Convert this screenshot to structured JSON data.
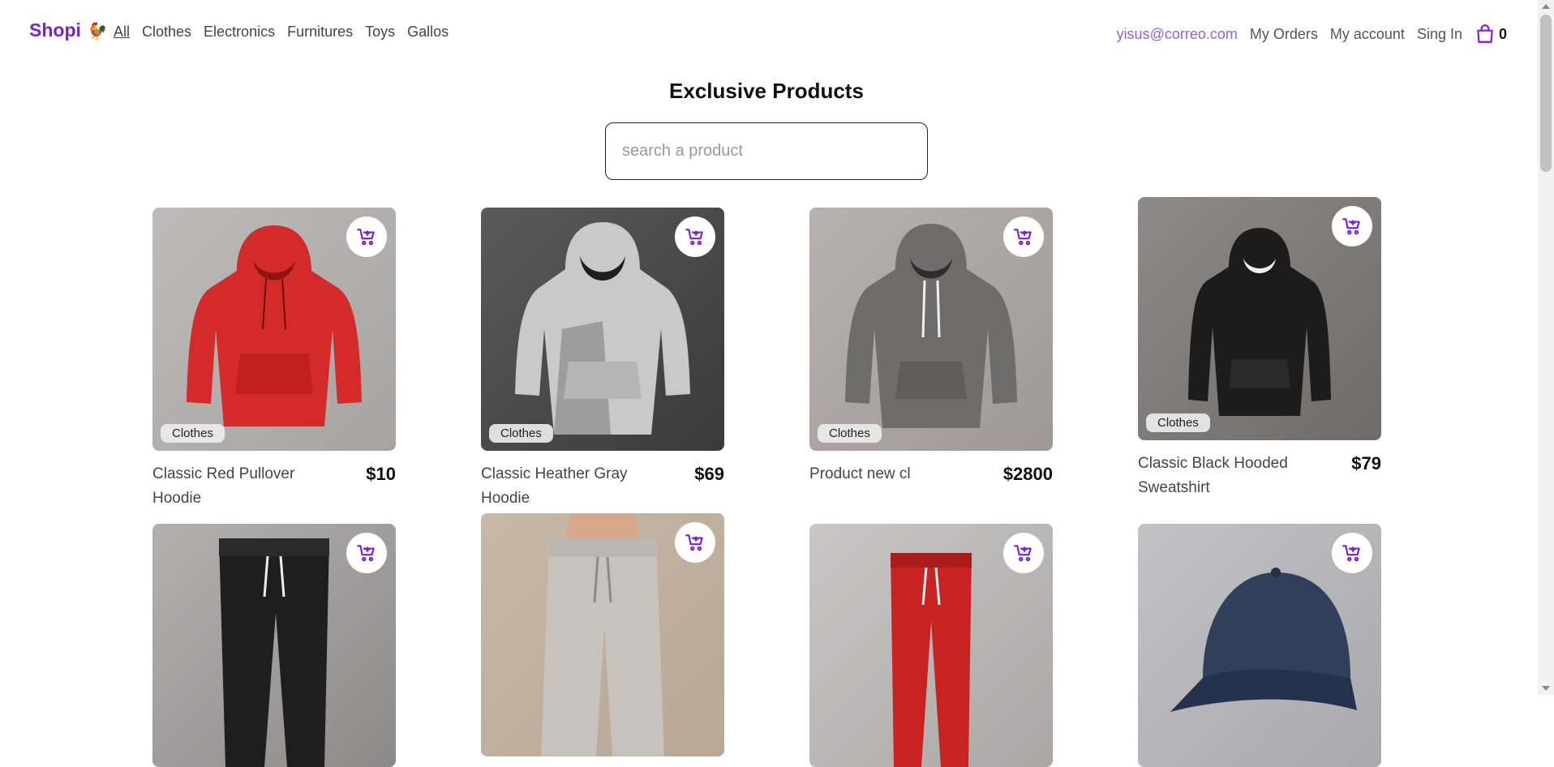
{
  "nav": {
    "logo": "Shopi",
    "logo_icon": "rooster-icon",
    "links": [
      "All",
      "Clothes",
      "Electronics",
      "Furnitures",
      "Toys",
      "Gallos"
    ],
    "email": "yisus@correo.com",
    "my_orders": "My Orders",
    "my_account": "My account",
    "sign_in": "Sing In",
    "cart_count": "0"
  },
  "main": {
    "title": "Exclusive Products",
    "search_placeholder": "search a product"
  },
  "products": [
    {
      "name": "Classic Red Pullover Hoodie",
      "price": "$10",
      "category": "Clothes",
      "image": "red-hoodie",
      "color": "#d42a2a"
    },
    {
      "name": "Classic Heather Gray Hoodie",
      "price": "$69",
      "category": "Clothes",
      "image": "gray-hoodie",
      "color": "#c9c9c9"
    },
    {
      "name": "Product new cl",
      "price": "$2800",
      "category": "Clothes",
      "image": "dark-gray-hoodie",
      "color": "#6f6c6c"
    },
    {
      "name": "Classic Black Hooded Sweatshirt",
      "price": "$79",
      "category": "Clothes",
      "image": "black-hoodie",
      "color": "#1c1c1c"
    },
    {
      "name": "",
      "price": "",
      "category": "",
      "image": "black-joggers",
      "color": "#1e1e1e"
    },
    {
      "name": "",
      "price": "",
      "category": "",
      "image": "light-gray-joggers",
      "color": "#c7c2bc"
    },
    {
      "name": "",
      "price": "",
      "category": "",
      "image": "red-joggers",
      "color": "#c82222"
    },
    {
      "name": "",
      "price": "",
      "category": "",
      "image": "navy-cap",
      "color": "#2f3f5c"
    }
  ],
  "colors": {
    "accent": "#7c1fd6",
    "email": "#9a5fd6"
  }
}
